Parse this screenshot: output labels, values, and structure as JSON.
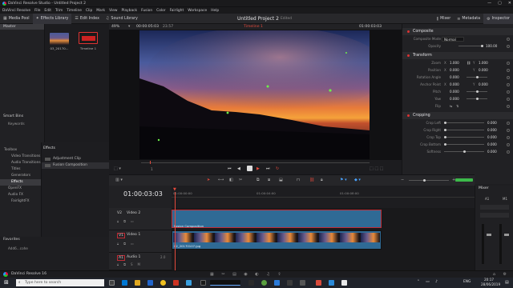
{
  "window": {
    "title": "DaVinci Resolve Studio - Untitled Project 2",
    "controls": [
      "—",
      "▢",
      "✕"
    ]
  },
  "menu": [
    "DaVinci Resolve",
    "File",
    "Edit",
    "Trim",
    "Timeline",
    "Clip",
    "Mark",
    "View",
    "Playback",
    "Fusion",
    "Color",
    "Fairlight",
    "Workspace",
    "Help"
  ],
  "toolbar": {
    "left": [
      "Media Pool",
      "Effects Library",
      "Edit Index",
      "Sound Library"
    ],
    "project": "Untitled Project 2",
    "edited": "Edited",
    "right": [
      "Mixer",
      "Metadata",
      "Inspector"
    ]
  },
  "media_pool": {
    "master": "Master",
    "smart_bins": "Smart Bins",
    "keywords": "Keywords",
    "clips": [
      {
        "name": "03_20170..."
      },
      {
        "name": "Timeline 1"
      }
    ]
  },
  "viewer": {
    "zoom": "49%",
    "source_tc": "00:00:05:03",
    "fit": "23.57",
    "timeline_name": "Timeline 1",
    "tc": "01:00:03:03",
    "page": "1"
  },
  "inspector": {
    "sections": [
      {
        "name": "Composite",
        "rows": [
          {
            "label": "Composite Mode",
            "value": "Normal"
          },
          {
            "label": "Opacity",
            "value": "100.00"
          }
        ]
      },
      {
        "name": "Transform",
        "rows": [
          {
            "label": "Zoom",
            "x": "1.000",
            "y": "1.000",
            "tag_x": "X",
            "tag_y": "Y"
          },
          {
            "label": "Position",
            "x": "0.000",
            "y": "0.000",
            "tag_x": "X",
            "tag_y": "Y"
          },
          {
            "label": "Rotation Angle",
            "v": "0.000"
          },
          {
            "label": "Anchor Point",
            "x": "0.000",
            "y": "0.000",
            "tag_x": "X",
            "tag_y": "Y"
          },
          {
            "label": "Pitch",
            "v": "0.000"
          },
          {
            "label": "Yaw",
            "v": "0.000"
          },
          {
            "label": "Flip",
            "v": ""
          }
        ]
      },
      {
        "name": "Cropping",
        "rows": [
          {
            "label": "Crop Left",
            "v": "0.000"
          },
          {
            "label": "Crop Right",
            "v": "0.000"
          },
          {
            "label": "Crop Top",
            "v": "0.000"
          },
          {
            "label": "Crop Bottom",
            "v": "0.000"
          },
          {
            "label": "Softness",
            "v": "0.000"
          }
        ]
      }
    ]
  },
  "effects": {
    "tree": [
      "Toolbox",
      "Video Transitions",
      "Audio Transitions",
      "Titles",
      "Generators",
      "Effects",
      "OpenFX",
      "Audio FX",
      "FairlightFX"
    ],
    "favorites": "Favorites",
    "fav_item": "Add6...cohe",
    "selected": "Effects",
    "panel_title": "Effects",
    "list": [
      "Adjustment Clip",
      "Fusion Composition"
    ]
  },
  "timeline": {
    "timecode": "01:00:03:03",
    "ruler": [
      "01:00:00:00",
      "01:00:04:00",
      "01:00:08:00"
    ],
    "tracks": [
      {
        "id": "V2",
        "name": "Video 2",
        "clip": "Fusion Composition"
      },
      {
        "id": "V1",
        "name": "Video 1",
        "clip": "02_20170107.jpg"
      },
      {
        "id": "A1",
        "name": "Audio 1",
        "level": "2.0"
      }
    ]
  },
  "mixer": {
    "title": "Mixer",
    "channels": [
      "A1",
      "M1"
    ]
  },
  "status": {
    "app": "DaVinci Resolve 16"
  },
  "taskbar": {
    "search": "Type here to search",
    "lang": "ENG",
    "time": "20:17",
    "date": "28/06/2019"
  },
  "colors": {
    "accent": "#e44a3c",
    "clip_blue": "#2f6a95",
    "track_sel": "#bf2b35"
  }
}
